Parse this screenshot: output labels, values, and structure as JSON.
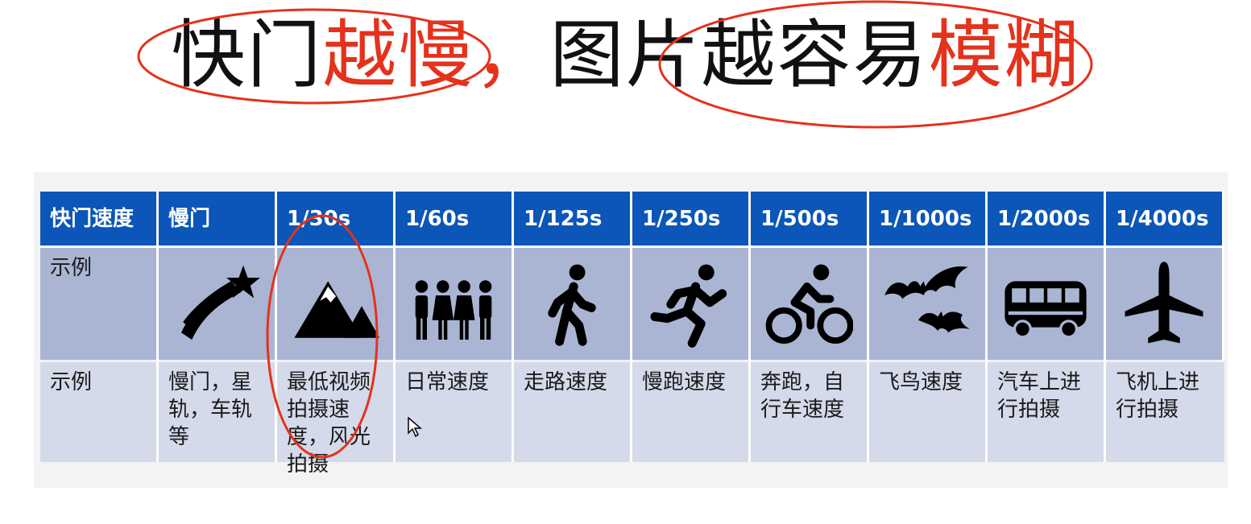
{
  "title": {
    "part1_black": "快门",
    "part1_red": "越慢，",
    "part2_black": "图片越容易",
    "part2_red": "模糊"
  },
  "colors": {
    "header_bg": "#0b56b8",
    "row2_bg": "#aab5d3",
    "row3_bg": "#d5daea",
    "accent_red": "#e4321c"
  },
  "table": {
    "header": [
      "快门速度",
      "慢门",
      "1/30s",
      "1/60s",
      "1/125s",
      "1/250s",
      "1/500s",
      "1/1000s",
      "1/2000s",
      "1/4000s"
    ],
    "icon_row_label": "示例",
    "icons": [
      "shooting-star-icon",
      "mountain-icon",
      "people-group-icon",
      "walking-person-icon",
      "running-person-icon",
      "cyclist-icon",
      "bats-icon",
      "bus-icon",
      "airplane-icon"
    ],
    "example_row_label": "示例",
    "examples": [
      "慢门，星轨，车轨等",
      "最低视频拍摄速度，风光拍摄",
      "日常速度",
      "走路速度",
      "慢跑速度",
      "奔跑，自行车速度",
      "飞鸟速度",
      "汽车上进行拍摄",
      "飞机上进行拍摄"
    ]
  }
}
